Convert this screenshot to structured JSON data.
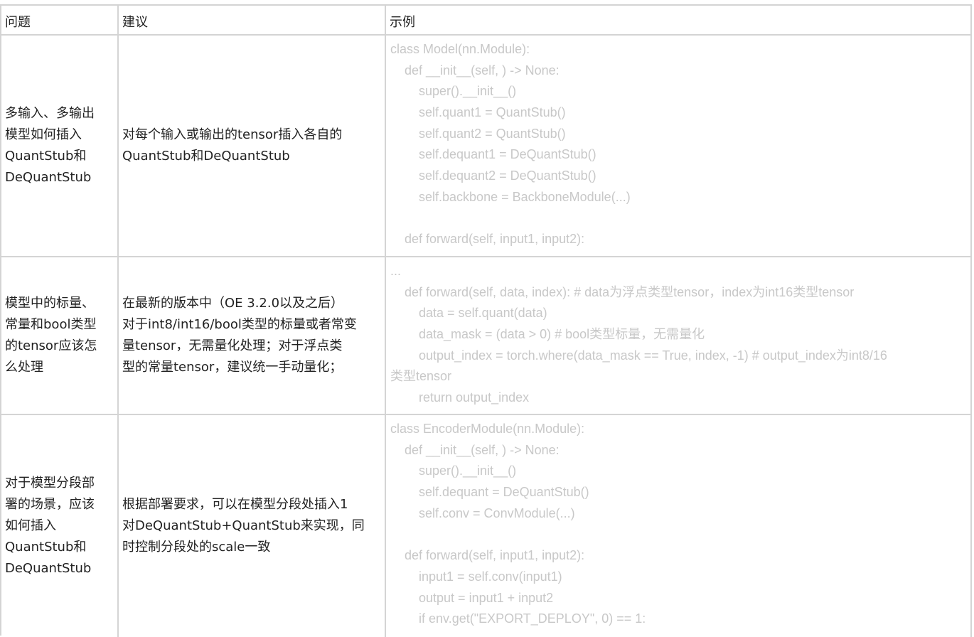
{
  "table": {
    "headers": [
      "问题",
      "建议",
      "示例"
    ],
    "rows": [
      {
        "problem": [
          "多输入、多输出",
          "模型如何插入",
          "QuantStub和",
          "DeQuantStub"
        ],
        "suggestion": [
          "对每个输入或输出的tensor插入各自的",
          "QuantStub和DeQuantStub"
        ],
        "example": [
          "class Model(nn.Module):",
          "    def __init__(self, ) -> None:",
          "        super().__init__()",
          "        self.quant1 = QuantStub()",
          "        self.quant2 = QuantStub()",
          "        self.dequant1 = DeQuantStub()",
          "        self.dequant2 = DeQuantStub()",
          "        self.backbone = BackboneModule(...)",
          "",
          "    def forward(self, input1, input2):"
        ]
      },
      {
        "problem": [
          "模型中的标量、",
          "常量和bool类型",
          "的tensor应该怎",
          "么处理"
        ],
        "suggestion": [
          "在最新的版本中（OE 3.2.0以及之后）",
          "对于int8/int16/bool类型的标量或者常变",
          "量tensor，无需量化处理；对于浮点类",
          "型的常量tensor，建议统一手动量化；"
        ],
        "example": [
          "...",
          "    def forward(self, data, index): # data为浮点类型tensor，index为int16类型tensor",
          "        data = self.quant(data)",
          "        data_mask = (data > 0) # bool类型标量，无需量化",
          "        output_index = torch.where(data_mask == True, index, -1) # output_index为int8/16",
          "类型tensor",
          "        return output_index"
        ]
      },
      {
        "problem": [
          "对于模型分段部",
          "署的场景，应该",
          "如何插入",
          "QuantStub和",
          "DeQuantStub"
        ],
        "suggestion": [
          "根据部署要求，可以在模型分段处插入1",
          "对DeQuantStub+QuantStub来实现，同",
          "时控制分段处的scale一致"
        ],
        "example": [
          "class EncoderModule(nn.Module):",
          "    def __init__(self, ) -> None:",
          "        super().__init__()",
          "        self.dequant = DeQuantStub()",
          "        self.conv = ConvModule(...)",
          "",
          "    def forward(self, input1, input2):",
          "        input1 = self.conv(input1)",
          "        output = input1 + input2",
          "        if env.get(\"EXPORT_DEPLOY\", 0) == 1:"
        ]
      }
    ]
  }
}
